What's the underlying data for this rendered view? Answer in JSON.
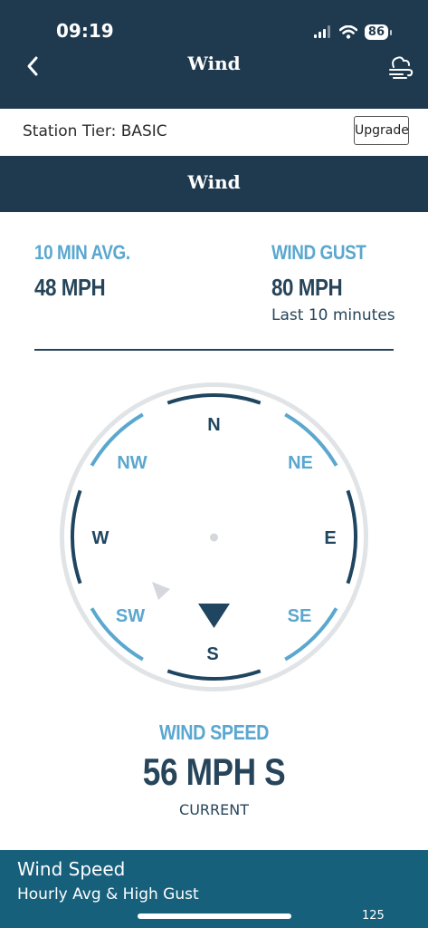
{
  "status_bar": {
    "time": "09:19",
    "battery": "86"
  },
  "nav": {
    "title": "Wind",
    "back_icon": "chevron-left-icon",
    "action_icon": "cloud-wind-icon"
  },
  "tier": {
    "label": "Station Tier: BASIC",
    "upgrade_label": "Upgrade"
  },
  "section": {
    "title": "Wind"
  },
  "stats": {
    "avg": {
      "label": "10 MIN AVG.",
      "value": "48 MPH"
    },
    "gust": {
      "label": "WIND GUST",
      "value": "80 MPH",
      "note": "Last 10 minutes"
    }
  },
  "compass": {
    "directions": {
      "n": "N",
      "ne": "NE",
      "e": "E",
      "se": "SE",
      "s": "S",
      "sw": "SW",
      "w": "W",
      "nw": "NW"
    },
    "current_direction": "S",
    "gust_direction": "SW",
    "colors": {
      "dark": "#1f4560",
      "light": "#5aa7cf",
      "ring": "#e1e4e7"
    }
  },
  "wind_speed": {
    "label": "WIND SPEED",
    "value": "56 MPH S",
    "sub": "CURRENT"
  },
  "bottom_panel": {
    "title": "Wind Speed",
    "subtitle": "Hourly Avg & High Gust",
    "partial_value": "125"
  }
}
